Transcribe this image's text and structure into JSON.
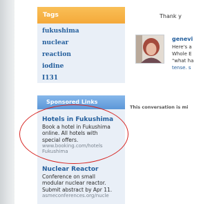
{
  "tags": {
    "title": "Tags",
    "items": [
      "fukushima",
      "nuclear",
      "reaction",
      "iodine",
      "I131"
    ]
  },
  "sponsored": {
    "title": "Sponsored Links",
    "ads": [
      {
        "title": "Hotels in Fukushima",
        "body": [
          "Book a hotel in Fukushima",
          "online. All hotels with",
          "special offers."
        ],
        "url": [
          "www.booking.com/hotels",
          "Fukushima"
        ]
      },
      {
        "title": "Nuclear Reactor",
        "body": [
          "Conference on small",
          "modular nuclear reactor.",
          "Submit abstract by Apr 11."
        ],
        "url": [
          "asmeconferences.org/nucle"
        ]
      }
    ]
  },
  "main": {
    "thank_you": "Thank y",
    "comment": {
      "name": "genevi",
      "lines": [
        "Here's a",
        "Whole E",
        "\"what ha",
        "tense. s"
      ]
    },
    "conversation_note": "This conversation is mi"
  },
  "colors": {
    "tags_header": "#f4a93a",
    "sponsored_header": "#5c97d8",
    "link": "#235e9c",
    "annotation_circle": "#d6221f"
  }
}
